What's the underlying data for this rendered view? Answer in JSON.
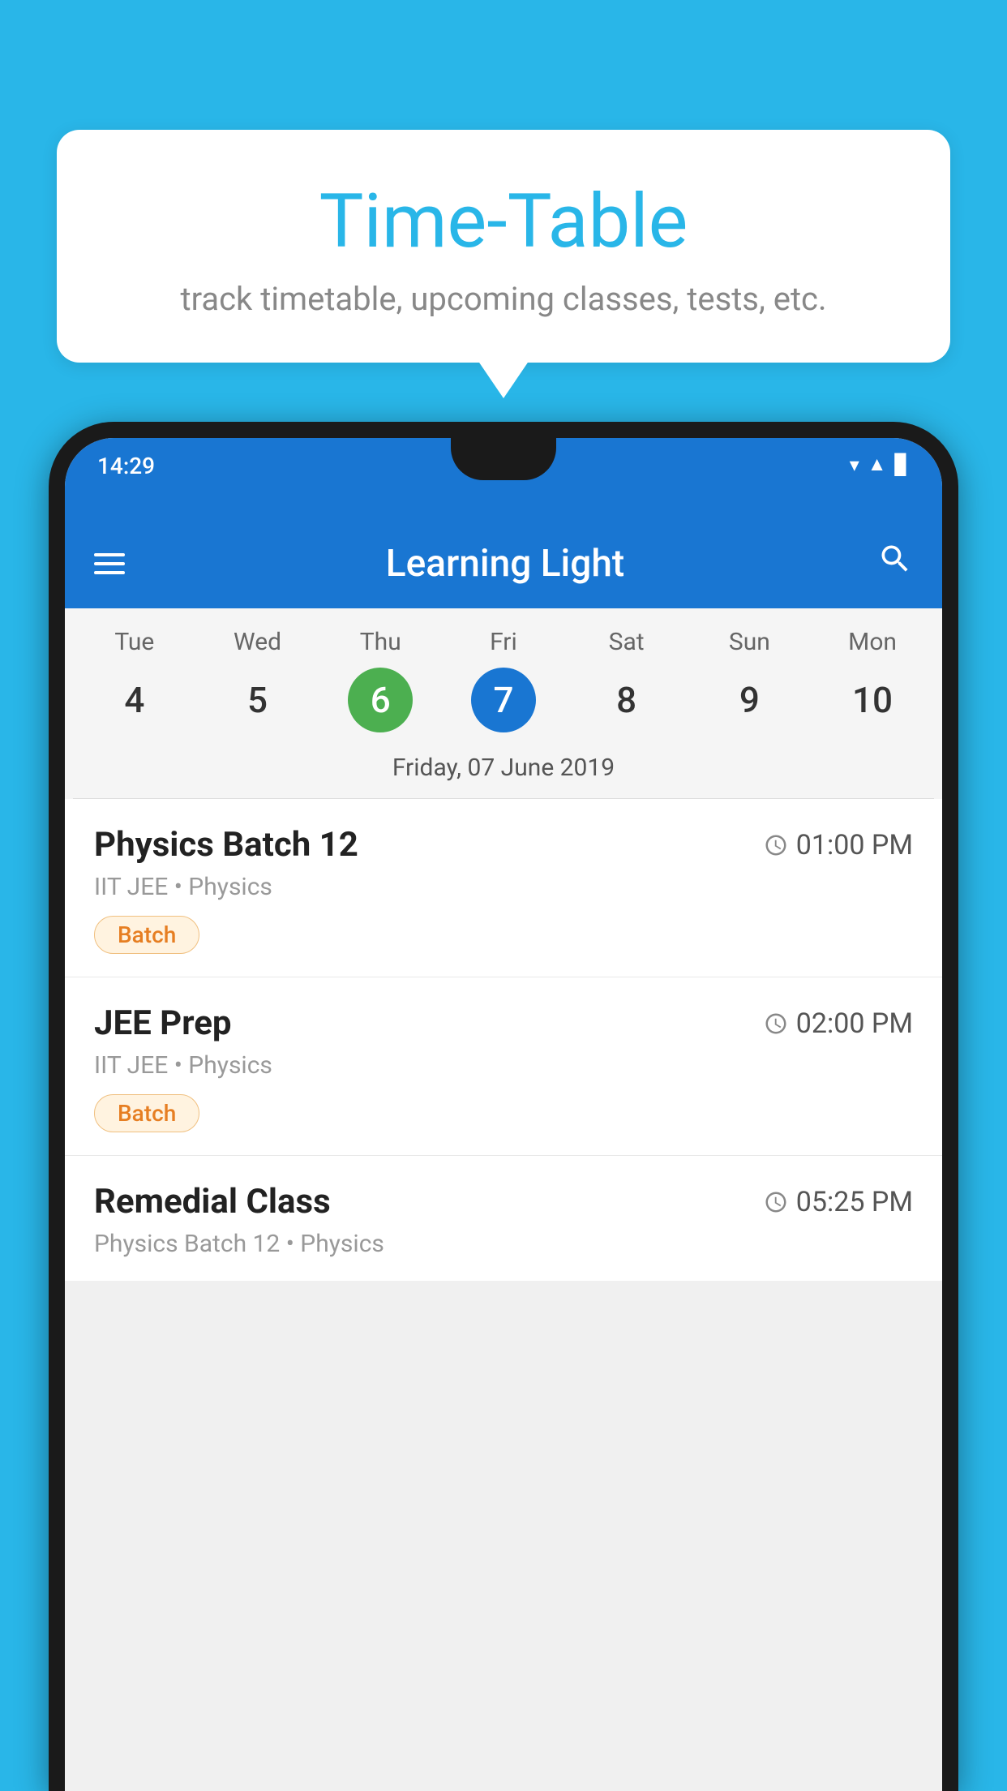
{
  "background": {
    "color": "#29b6e8"
  },
  "speech_bubble": {
    "title": "Time-Table",
    "subtitle": "track timetable, upcoming classes, tests, etc."
  },
  "status_bar": {
    "time": "14:29"
  },
  "app_bar": {
    "title": "Learning Light"
  },
  "calendar": {
    "days": [
      {
        "name": "Tue",
        "num": "4",
        "state": "normal"
      },
      {
        "name": "Wed",
        "num": "5",
        "state": "normal"
      },
      {
        "name": "Thu",
        "num": "6",
        "state": "today"
      },
      {
        "name": "Fri",
        "num": "7",
        "state": "selected"
      },
      {
        "name": "Sat",
        "num": "8",
        "state": "normal"
      },
      {
        "name": "Sun",
        "num": "9",
        "state": "normal"
      },
      {
        "name": "Mon",
        "num": "10",
        "state": "normal"
      }
    ],
    "selected_date_label": "Friday, 07 June 2019"
  },
  "schedule": [
    {
      "title": "Physics Batch 12",
      "time": "01:00 PM",
      "subtitle": "IIT JEE • Physics",
      "badge": "Batch"
    },
    {
      "title": "JEE Prep",
      "time": "02:00 PM",
      "subtitle": "IIT JEE • Physics",
      "badge": "Batch"
    },
    {
      "title": "Remedial Class",
      "time": "05:25 PM",
      "subtitle": "Physics Batch 12 • Physics",
      "badge": null
    }
  ]
}
